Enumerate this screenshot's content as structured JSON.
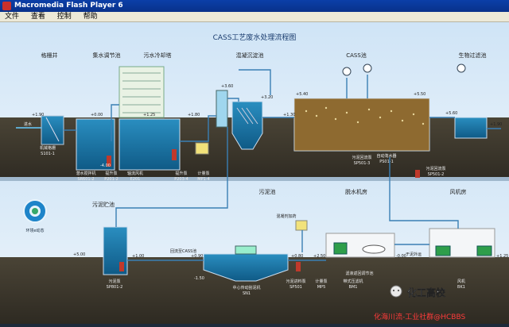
{
  "window": {
    "title": "Macromedia Flash Player 6"
  },
  "menu": [
    "文件",
    "查看",
    "控制",
    "帮助"
  ],
  "diagram": {
    "title": "CASS工艺废水处理流程图",
    "sections": {
      "grid_well": "格栅井",
      "equalization": "集水调节池",
      "cooling_tower": "污水冷却塔",
      "coag_settle": "混凝沉淀池",
      "cass": "CASS池",
      "biofilter": "生物过滤池",
      "sludge_storage": "污泥贮池",
      "sludge_tank": "污泥池",
      "dewater": "脱水机房",
      "blower": "风机房"
    },
    "labels": {
      "grid_machine": "机械格栅",
      "grid_code": "S101-1",
      "inlet": "进水",
      "submersible_mixer": "潜水搅拌机",
      "mixer_code": "SR601-2",
      "lift_pump": "提升泵",
      "lift_code": "P201-2",
      "fan": "轴流风机",
      "fan_code": "E201",
      "metering_pump1": "提升泵",
      "metering_code1": "P203-4",
      "metering_pump2": "计量泵",
      "metering_code2": "MP1-4",
      "decanter": "自动滗水器",
      "decanter_code": "PS01-1",
      "return_pump": "污泥回流泵",
      "return_code": "SP501-3",
      "sludge_pump": "污泥回流泵",
      "sludge_code": "SP501-2",
      "cass_pipe": "回流至CASS池",
      "pam_tank": "混凝剂加药",
      "storage_pump": "污泥泵",
      "storage_pump_code": "SP801-2",
      "mixer2": "中心传动刮泥机",
      "mixer2_code": "SN1",
      "dewater_pump": "污泥进料泵",
      "dewater_pump_code": "SP501",
      "meter3": "计量泵",
      "meter3_code": "MP5",
      "press": "带式压滤机",
      "press_code": "BM1",
      "blower_unit": "风机",
      "blower_code": "BK1",
      "dry_sludge": "干泥外运",
      "filtrate": "滤液返回调节池",
      "logo_caption": "环境e动态"
    },
    "elevations": {
      "e1": "+1.90",
      "e2": "+0.00",
      "e3": "-4.00",
      "e4": "+1.25",
      "e5": "+1.80",
      "e6": "+3.60",
      "e7": "+3.20",
      "e8": "+1.30",
      "e9": "+5.40",
      "e10": "+5.50",
      "e11": "+5.60",
      "e12": "+1.90",
      "e13": "+5.00",
      "e14": "+1.00",
      "e15": "+0.90",
      "e16": "+0.60",
      "e17": "-1.50",
      "e18": "-2.00",
      "e19": "+0.80",
      "e20": "-1.70",
      "e21": "-1.60",
      "e22": "+2.50",
      "e23": "-0.00",
      "e24": "-4.50",
      "e25": "+1.25"
    }
  },
  "watermark": {
    "badge_text": "化工高校",
    "footer_text": "化海川流-工业社群@HCBBS"
  }
}
